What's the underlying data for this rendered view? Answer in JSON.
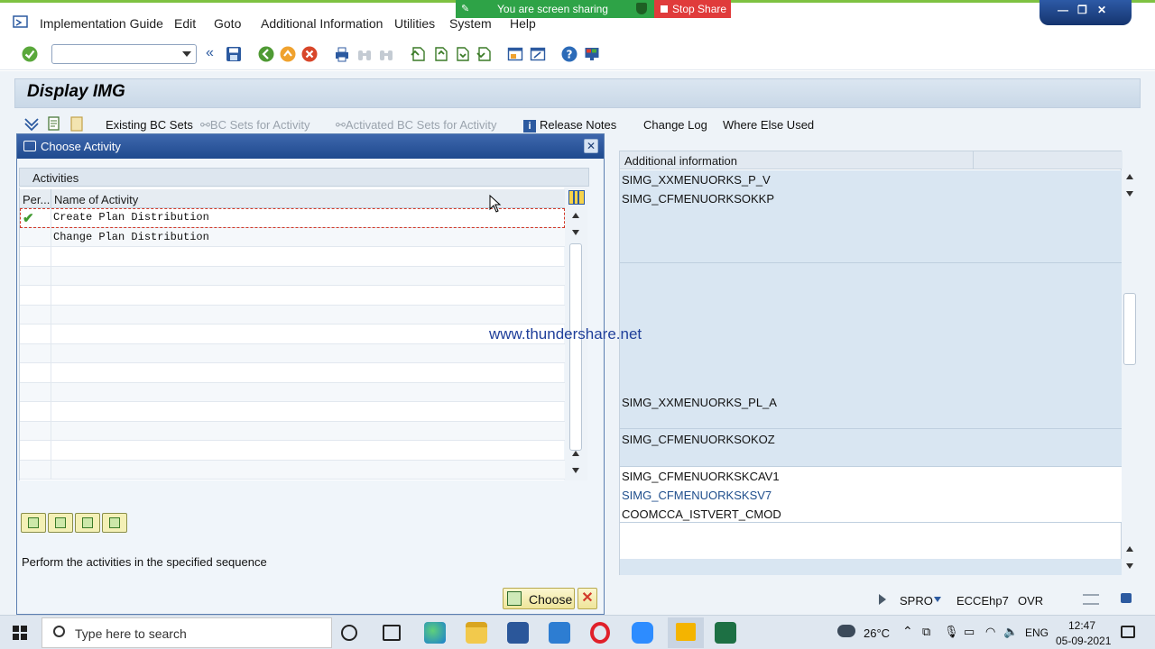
{
  "menu": {
    "items": [
      "Implementation Guide",
      "Edit",
      "Goto",
      "Additional Information",
      "Utilities",
      "System",
      "Help"
    ]
  },
  "screen_share": {
    "status": "You are screen sharing",
    "stop_label": "Stop Share"
  },
  "page": {
    "title": "Display IMG"
  },
  "app_toolbar": {
    "existing_bc_sets": "Existing BC Sets",
    "bc_sets_for_activity": "BC Sets for Activity",
    "activated_bc_sets": "Activated BC Sets for Activity",
    "release_notes": "Release Notes",
    "change_log": "Change Log",
    "where_else_used": "Where Else Used"
  },
  "right_table": {
    "header": "Additional information",
    "cells": [
      "SIMG_XXMENUORKS_P_V",
      "SIMG_CFMENUORKSOKKP",
      "SIMG_XXMENUORKS_PL_A",
      "SIMG_CFMENUORKSOKOZ",
      "SIMG_CFMENUORKSKCAV1",
      "SIMG_CFMENUORKSKSV7",
      "COOMCCA_ISTVERT_CMOD"
    ]
  },
  "dialog": {
    "title": "Choose Activity",
    "section": "Activities",
    "col_performed": "Per...",
    "col_name": "Name of Activity",
    "rows": [
      "Create Plan Distribution",
      "Change Plan Distribution"
    ],
    "hint": "Perform the activities in the specified sequence",
    "choose_label": "Choose"
  },
  "watermark": "www.thundershare.net",
  "status_bar": {
    "transaction": "SPRO",
    "system": "ECCEhp7",
    "mode": "OVR"
  },
  "taskbar": {
    "search_placeholder": "Type here to search",
    "temperature": "26°C",
    "language": "ENG",
    "time": "12:47",
    "date": "05-09-2021"
  },
  "colors": {
    "title_bar_blue": "#1f4a8e",
    "share_green": "#2ea347",
    "stop_red": "#e03b3b",
    "link_blue": "#1f4e8c"
  }
}
